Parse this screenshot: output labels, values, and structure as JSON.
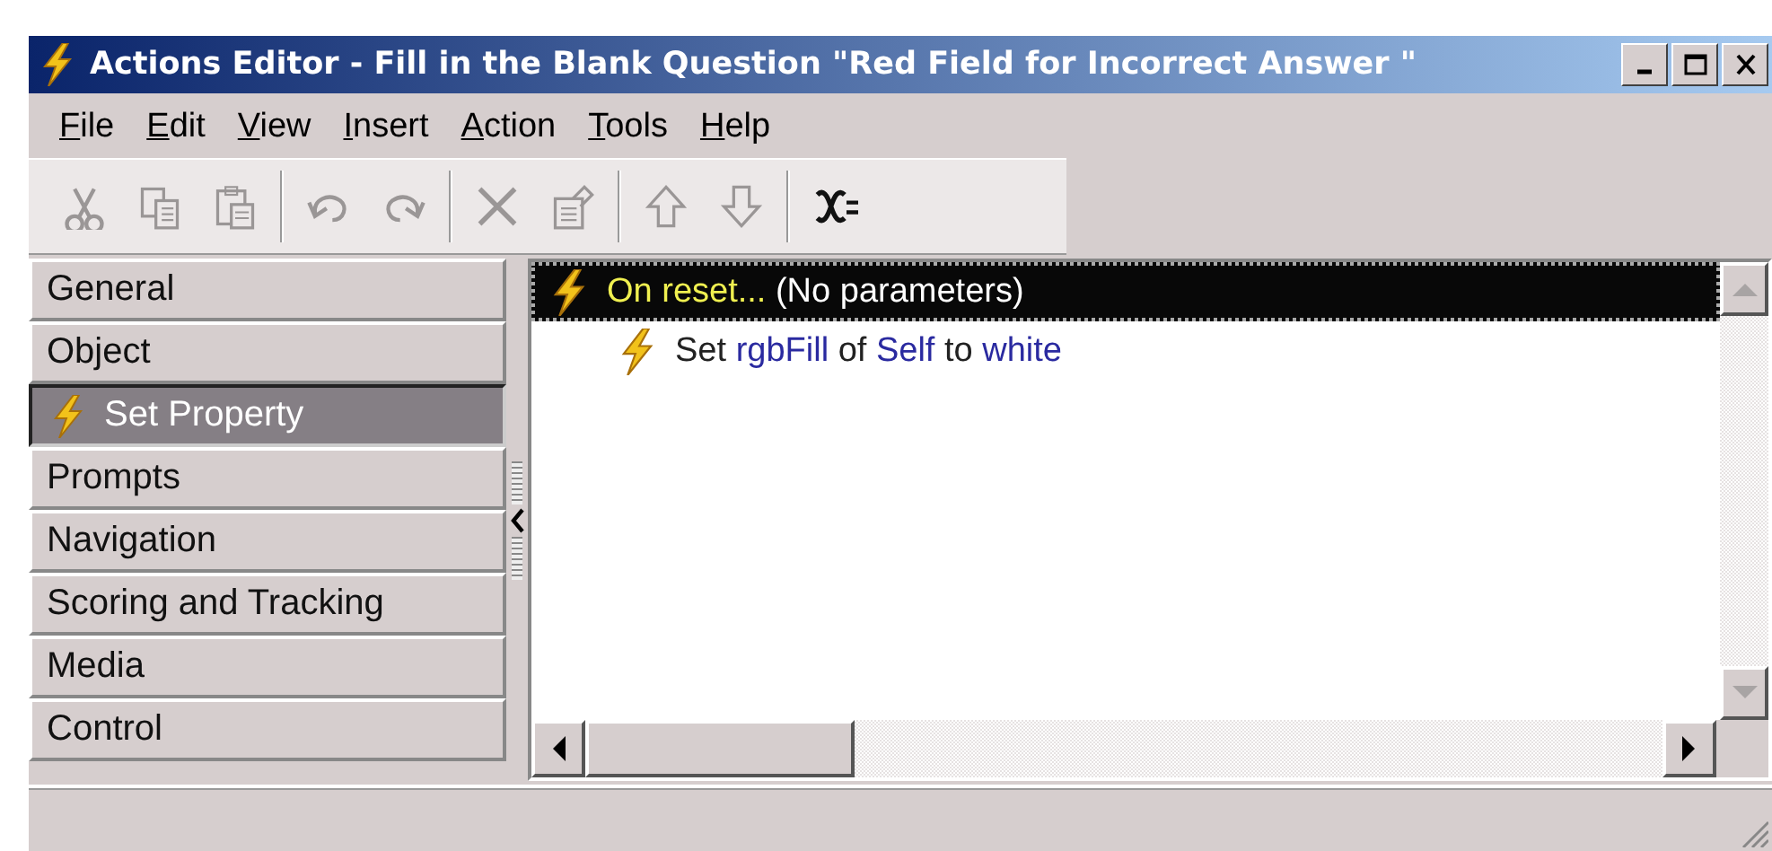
{
  "window": {
    "title": "Actions Editor - Fill in the Blank Question \"Red Field for Incorrect Answer \""
  },
  "menu": [
    "File",
    "Edit",
    "View",
    "Insert",
    "Action",
    "Tools",
    "Help"
  ],
  "toolbar": [
    [
      {
        "kind": "cut",
        "disabled": true
      },
      {
        "kind": "copy",
        "disabled": true
      },
      {
        "kind": "paste",
        "disabled": true
      }
    ],
    [
      {
        "kind": "undo",
        "disabled": true
      },
      {
        "kind": "redo",
        "disabled": true
      }
    ],
    [
      {
        "kind": "delete",
        "disabled": true
      },
      {
        "kind": "properties",
        "disabled": true
      }
    ],
    [
      {
        "kind": "up",
        "disabled": true
      },
      {
        "kind": "down",
        "disabled": true
      }
    ],
    [
      {
        "kind": "variable",
        "disabled": false
      }
    ]
  ],
  "sidebar": {
    "items": [
      {
        "label": "General",
        "selected": false
      },
      {
        "label": "Object",
        "selected": false
      },
      {
        "label": "Set Property",
        "selected": true
      },
      {
        "label": "Prompts",
        "selected": false
      },
      {
        "label": "Navigation",
        "selected": false
      },
      {
        "label": "Scoring and Tracking",
        "selected": false
      },
      {
        "label": "Media",
        "selected": false
      },
      {
        "label": "Control",
        "selected": false
      }
    ]
  },
  "tree": {
    "items": [
      {
        "selected": true,
        "parts": [
          {
            "text": "On reset...",
            "kind": "event"
          },
          {
            "text": " (No parameters)",
            "kind": "plain"
          }
        ],
        "children": [
          {
            "selected": false,
            "parts": [
              {
                "text": "Set ",
                "kind": "plain"
              },
              {
                "text": "rgbFill",
                "kind": "value"
              },
              {
                "text": " of ",
                "kind": "plain"
              },
              {
                "text": "Self",
                "kind": "value"
              },
              {
                "text": " to ",
                "kind": "plain"
              },
              {
                "text": "white",
                "kind": "value"
              }
            ]
          }
        ]
      }
    ]
  }
}
